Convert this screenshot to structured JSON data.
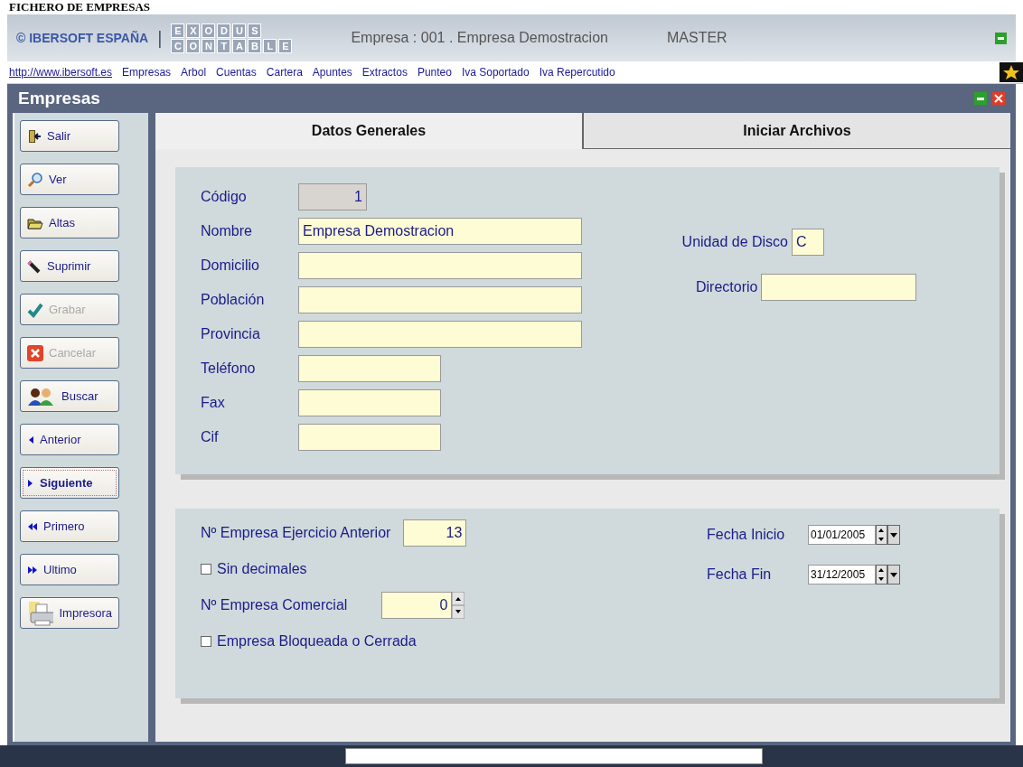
{
  "page_title": "FICHERO DE EMPRESAS",
  "header": {
    "brand": "© IBERSOFT ESPAÑA",
    "separator": "|",
    "logo_top": [
      "E",
      "X",
      "O",
      "D",
      "U",
      "S"
    ],
    "logo_bottom": [
      "C",
      "O",
      "N",
      "T",
      "A",
      "B",
      "L",
      "E"
    ],
    "company": "Empresa : 001 . Empresa Demostracion",
    "user": "MASTER"
  },
  "menu": [
    {
      "label": "http://www.ibersoft.es",
      "kind": "url"
    },
    {
      "label": "Empresas",
      "kind": "item"
    },
    {
      "label": "Arbol",
      "kind": "item"
    },
    {
      "label": "Cuentas",
      "kind": "item"
    },
    {
      "label": "Cartera",
      "kind": "item"
    },
    {
      "label": "Apuntes",
      "kind": "item"
    },
    {
      "label": "Extractos",
      "kind": "item"
    },
    {
      "label": "Punteo",
      "kind": "item"
    },
    {
      "label": "Iva Soportado",
      "kind": "item"
    },
    {
      "label": "Iva Repercutido",
      "kind": "item"
    }
  ],
  "window": {
    "title": "Empresas"
  },
  "buttons": [
    {
      "label": "Salir",
      "kind": "exit",
      "disabled": false,
      "selected": false
    },
    {
      "label": "Ver",
      "kind": "search",
      "disabled": false,
      "selected": false
    },
    {
      "label": "Altas",
      "kind": "folder",
      "disabled": false,
      "selected": false
    },
    {
      "label": "Suprimir",
      "kind": "pencil",
      "disabled": false,
      "selected": false
    },
    {
      "label": "Grabar",
      "kind": "check",
      "disabled": true,
      "selected": false
    },
    {
      "label": "Cancelar",
      "kind": "cancel",
      "disabled": true,
      "selected": false
    },
    {
      "label": "Buscar",
      "kind": "people",
      "disabled": false,
      "selected": false
    },
    {
      "label": "Anterior",
      "kind": "prev",
      "disabled": false,
      "selected": false
    },
    {
      "label": "Siguiente",
      "kind": "next",
      "disabled": false,
      "selected": true
    },
    {
      "label": "Primero",
      "kind": "first",
      "disabled": false,
      "selected": false
    },
    {
      "label": "Ultimo",
      "kind": "last",
      "disabled": false,
      "selected": false
    },
    {
      "label": "Impresora",
      "kind": "printer",
      "disabled": false,
      "selected": false
    }
  ],
  "tabs": [
    {
      "label": "Datos Generales",
      "selected": true
    },
    {
      "label": "Iniciar Archivos",
      "selected": false
    }
  ],
  "general_fields": [
    {
      "label": "Código",
      "value": "1",
      "kind": "code"
    },
    {
      "label": "Nombre",
      "value": "Empresa Demostracion",
      "kind": "long"
    },
    {
      "label": "Domicilio",
      "kind": "long"
    },
    {
      "label": "Población",
      "kind": "long"
    },
    {
      "label": "Provincia",
      "kind": "long"
    },
    {
      "label": "Teléfono",
      "kind": "short"
    },
    {
      "label": "Fax",
      "kind": "short"
    },
    {
      "label": "Cif",
      "kind": "short"
    }
  ],
  "disk": {
    "label": "Unidad de Disco",
    "value": "C"
  },
  "directory": {
    "label": "Directorio"
  },
  "previous_company": {
    "label": "Nº Empresa Ejercicio Anterior",
    "value": "13"
  },
  "no_decimals": {
    "label": "Sin decimales",
    "checked": false
  },
  "commercial_company": {
    "label": "Nº Empresa Comercial",
    "value": "0"
  },
  "locked": {
    "label": "Empresa Bloqueada o Cerrada",
    "checked": false
  },
  "start_date": {
    "label": "Fecha Inicio",
    "value": "01/01/2005"
  },
  "end_date": {
    "label": "Fecha Fin",
    "value": "31/12/2005"
  }
}
